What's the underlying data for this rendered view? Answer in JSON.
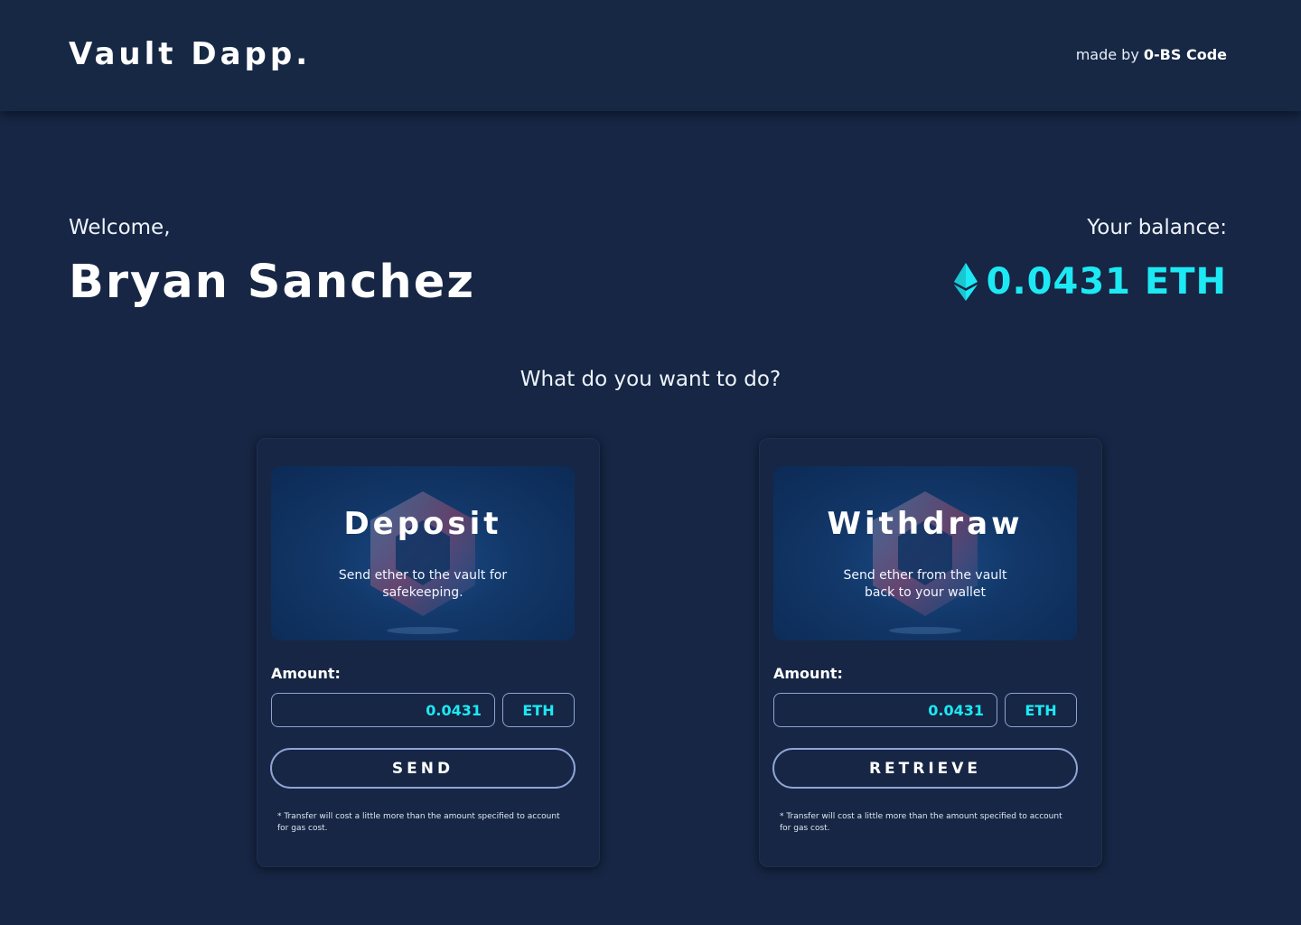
{
  "header": {
    "logo": "Vault Dapp.",
    "credit_prefix": "made by",
    "credit_name": "0-BS Code"
  },
  "user": {
    "welcome": "Welcome,",
    "name": "Bryan Sanchez"
  },
  "balance": {
    "label": "Your balance:",
    "value": "0.0431 ETH",
    "icon": "ethereum-icon",
    "accent_color": "#1de9f4"
  },
  "prompt": "What do you want to do?",
  "deposit": {
    "title": "Deposit",
    "description": "Send ether to the vault for safekeeping.",
    "amount_label": "Amount:",
    "amount_value": "0.0431",
    "unit": "ETH",
    "button": "SEND",
    "note": "* Transfer will cost a little more than the amount specified to account for gas cost."
  },
  "withdraw": {
    "title": "Withdraw",
    "description": "Send ether from the vault back to your wallet",
    "amount_label": "Amount:",
    "amount_value": "0.0431",
    "unit": "ETH",
    "button": "RETRIEVE",
    "note": "* Transfer will cost a little more than the amount specified to account for gas cost."
  }
}
